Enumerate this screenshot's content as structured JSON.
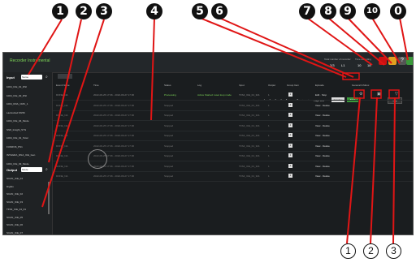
{
  "markers": [
    "1",
    "2",
    "3",
    "4",
    "5",
    "6",
    "7",
    "8",
    "9",
    "10",
    "0"
  ],
  "bottom_markers": [
    "1",
    "2",
    "3"
  ],
  "app": {
    "title": "Recorder Instrumental",
    "topbar": {
      "total_label": "Total number of recorder",
      "total_value": "2/3",
      "total_sub": "L1",
      "rec_label": "Time recording",
      "rec_value": "10",
      "rec_sub": "18"
    }
  },
  "sidebar": {
    "input_title": "Input",
    "input_select": "Name",
    "output_title": "Output",
    "output_select": "Mode",
    "input_items": [
      "1004_ICE_01_DSI",
      "1004_ICE_02_DSI",
      "1004_DNA_CMC_1",
      "Lactosized SN56",
      "1004_ICE_04_Mode",
      "Shift_Insight_SYS",
      "1004_ICE_01_Total",
      "FUNRNS_PS1",
      "INTEGRA_DNA_ICE_Gen",
      "1004_ICE_03_Mode"
    ],
    "output_items": [
      "SCAN_ICE_04",
      "DigStx",
      "SCAN_ICE_02",
      "SCAN_ICE_03",
      "TFS4_ICE_04_01",
      "SCAN_ICE_05",
      "SCAN_ICE_06",
      "SCAN_ICE_07"
    ]
  },
  "controls": {
    "pages": [
      "«",
      "‹",
      "1",
      "2",
      "3",
      "4",
      "5",
      "...",
      "8",
      "›",
      "»"
    ],
    "page_size_label": "Page size",
    "page_size_value": "Number",
    "btn_a": "Start",
    "btn_b": "Stop"
  },
  "table": {
    "headers": [
      "Event Name",
      "Time",
      "Status",
      "Log",
      "Input",
      "Output",
      "Group Item",
      "Episode",
      "General Infobox"
    ],
    "rows": [
      {
        "name": "DONE_NA",
        "time": "2022-06-25 17:36 - 2022-06-27 17:36",
        "status": "Processing",
        "log": "Active Started: reset loop mode",
        "input": "TFS4_ICE_01_321",
        "output": "1",
        "group": "1",
        "episode": "Edit · Stop"
      },
      {
        "name": "DONE_NA",
        "time": "2022-06-25 17:36 - 2022-06-27 17:36",
        "status": "Stopped",
        "log": "",
        "input": "TFS4_ICE_01_321",
        "output": "1",
        "group": "1",
        "episode": "View · Delete"
      },
      {
        "name": "DONE_NA",
        "time": "2022-06-25 17:36 - 2022-06-27 17:36",
        "status": "Stopped",
        "log": "",
        "input": "TFS4_ICE_01_321",
        "output": "1",
        "group": "1",
        "episode": "View · Delete"
      },
      {
        "name": "DONE_NA",
        "time": "2022-06-25 17:36 - 2022-06-27 17:36",
        "status": "Stopped",
        "log": "",
        "input": "TFS4_ICE_01_321",
        "output": "1",
        "group": "1",
        "episode": "View · Delete"
      },
      {
        "name": "DONE_NA",
        "time": "2022-06-25 17:36 - 2022-06-27 17:36",
        "status": "Stopped",
        "log": "",
        "input": "TFS4_ICE_01_321",
        "output": "1",
        "group": "1",
        "episode": "View · Delete"
      },
      {
        "name": "DONE_NA",
        "time": "2022-06-25 17:36 - 2022-06-27 17:36",
        "status": "Stopped",
        "log": "",
        "input": "TFS4_ICE_01_321",
        "output": "1",
        "group": "1",
        "episode": "View · Delete"
      },
      {
        "name": "DONE_NA",
        "time": "2022-06-25 17:36 - 2022-06-27 17:36",
        "status": "Stopped",
        "log": "",
        "input": "TFS4_ICE_01_321",
        "output": "1",
        "group": "1",
        "episode": "View · Delete"
      },
      {
        "name": "DONE_NA",
        "time": "2022-06-25 17:36 - 2022-06-27 17:36",
        "status": "Stopped",
        "log": "",
        "input": "TFS4_ICE_01_321",
        "output": "1",
        "group": "1",
        "episode": "View · Delete"
      },
      {
        "name": "DONE_NA",
        "time": "2022-06-25 17:36 - 2022-06-27 17:36",
        "status": "Stopped",
        "log": "",
        "input": "TFS4_ICE_01_321",
        "output": "1",
        "group": "1",
        "episode": "View · Delete"
      }
    ]
  },
  "colors": {
    "accent_green": "#7fd858",
    "red": "#cc1111",
    "orange": "#e0a020"
  }
}
